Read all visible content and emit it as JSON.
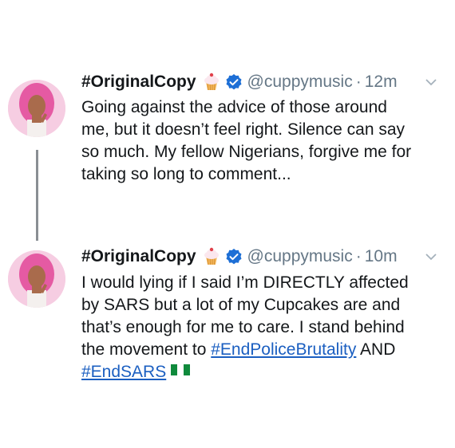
{
  "tweets": [
    {
      "display_name": "#OriginalCopy",
      "emoji": "cupcake",
      "handle": "@cuppymusic",
      "separator": "·",
      "time": "12m",
      "lines": [
        "Going against the advice of those around",
        "me, but it doesn’t feel right. Silence can say",
        "so much. My fellow Nigerians, forgive me for",
        "taking so long to comment..."
      ]
    },
    {
      "display_name": "#OriginalCopy",
      "emoji": "cupcake",
      "handle": "@cuppymusic",
      "separator": "·",
      "time": "10m",
      "lines": [
        "I would lying if I said I’m DIRECTLY affected",
        "by SARS but a lot of my Cupcakes are and",
        "that’s enough for me to care. I stand behind"
      ],
      "line4_text": "the movement to ",
      "hashtag1": "#EndPoliceBrutality",
      "line4_tail": " AND",
      "hashtag2": "#EndSARS",
      "flag": "nigeria-flag"
    }
  ],
  "colors": {
    "text": "#14171a",
    "muted": "#657786",
    "link": "#1b5fc1",
    "verified": "#1d6fd6",
    "thread_line": "#8a8f94"
  }
}
